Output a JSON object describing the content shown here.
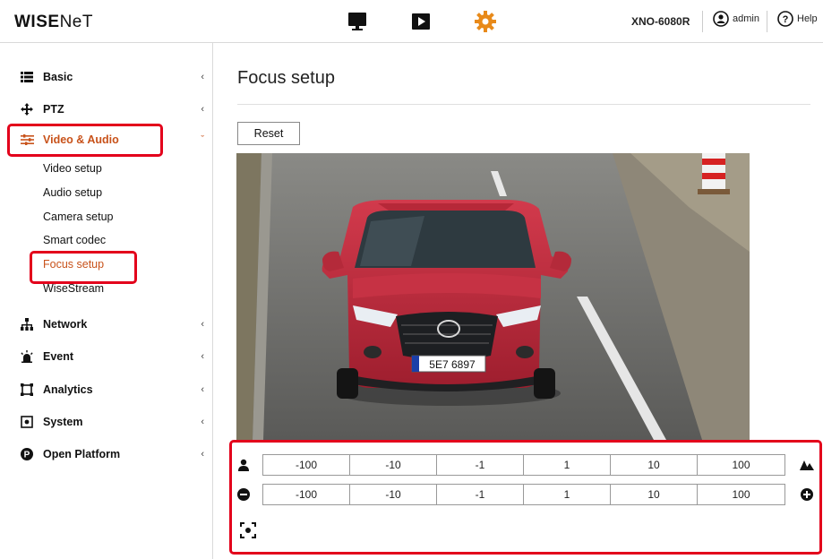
{
  "header": {
    "logo_bold": "WISE",
    "logo_thin": "NeT",
    "model": "XNO-6080R",
    "user": "admin",
    "help": "Help",
    "icons": [
      "monitor-icon",
      "play-icon",
      "gear-icon"
    ],
    "accent": "#e88a1a"
  },
  "sidebar": {
    "items": [
      {
        "label": "Basic",
        "icon": "list-icon"
      },
      {
        "label": "PTZ",
        "icon": "move-arrows-icon"
      },
      {
        "label": "Video & Audio",
        "icon": "sliders-icon",
        "expanded": true
      },
      {
        "label": "Network",
        "icon": "network-icon"
      },
      {
        "label": "Event",
        "icon": "alarm-icon"
      },
      {
        "label": "Analytics",
        "icon": "frame-icon"
      },
      {
        "label": "System",
        "icon": "system-icon"
      },
      {
        "label": "Open Platform",
        "icon": "platform-icon"
      }
    ],
    "subitems": [
      "Video setup",
      "Audio setup",
      "Camera setup",
      "Smart codec",
      "Focus setup",
      "WiseStream"
    ],
    "active_color": "#c8521a"
  },
  "main": {
    "title": "Focus setup",
    "reset_label": "Reset",
    "video": {
      "plate": "5E7 6897"
    },
    "zoom_steps": [
      "-100",
      "-10",
      "-1",
      "1",
      "10",
      "100"
    ],
    "focus_steps": [
      "-100",
      "-10",
      "-1",
      "1",
      "10",
      "100"
    ]
  },
  "highlight_color": "#e3001b"
}
